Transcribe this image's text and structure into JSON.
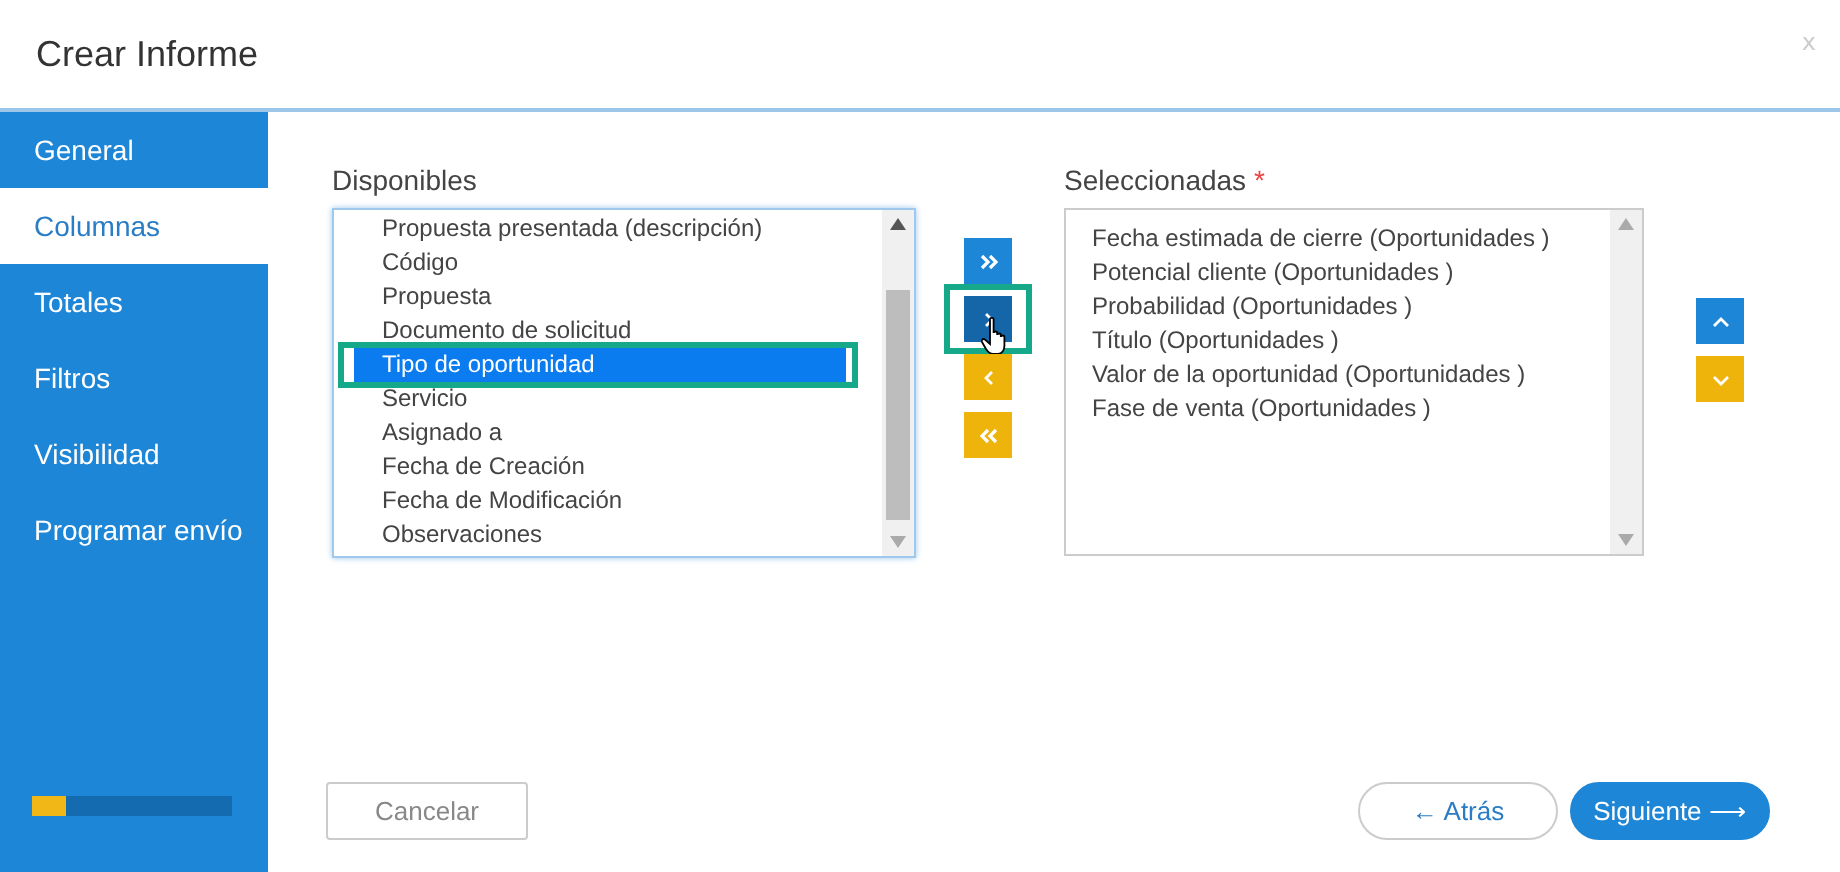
{
  "dialog": {
    "title": "Crear Informe",
    "close": "x"
  },
  "sidebar": {
    "items": [
      {
        "label": "General",
        "selected": false
      },
      {
        "label": "Columnas",
        "selected": true
      },
      {
        "label": "Totales",
        "selected": false
      },
      {
        "label": "Filtros",
        "selected": false
      },
      {
        "label": "Visibilidad",
        "selected": false
      },
      {
        "label": "Programar envío",
        "selected": false
      }
    ],
    "progress": {
      "level": 0.17
    }
  },
  "available": {
    "label": "Disponibles",
    "items": [
      {
        "label": "Propuesta presentada (descripción)",
        "selected": false,
        "highlighted": false
      },
      {
        "label": "Código",
        "selected": false,
        "highlighted": false
      },
      {
        "label": "Propuesta",
        "selected": false,
        "highlighted": false
      },
      {
        "label": "Documento de solicitud",
        "selected": false,
        "highlighted": false
      },
      {
        "label": "Tipo de oportunidad",
        "selected": true,
        "highlighted": true
      },
      {
        "label": "Servicio",
        "selected": false,
        "highlighted": false
      },
      {
        "label": "Asignado a",
        "selected": false,
        "highlighted": false
      },
      {
        "label": "Fecha de Creación",
        "selected": false,
        "highlighted": false
      },
      {
        "label": "Fecha de Modificación",
        "selected": false,
        "highlighted": false
      },
      {
        "label": "Observaciones",
        "selected": false,
        "highlighted": false
      }
    ]
  },
  "transfer_buttons": [
    {
      "kind": "add_all",
      "hovered": false,
      "highlighted": false
    },
    {
      "kind": "add",
      "hovered": true,
      "highlighted": true
    },
    {
      "kind": "remove",
      "hovered": false,
      "highlighted": false
    },
    {
      "kind": "remove_all",
      "hovered": false,
      "highlighted": false
    }
  ],
  "selected_list": {
    "label": "Seleccionadas",
    "required_mark": "*",
    "items": [
      {
        "label": "Fecha estimada de cierre (Oportunidades )"
      },
      {
        "label": "Potencial cliente (Oportunidades )"
      },
      {
        "label": "Probabilidad (Oportunidades )"
      },
      {
        "label": "Título (Oportunidades )"
      },
      {
        "label": "Valor de la oportunidad (Oportunidades )"
      },
      {
        "label": "Fase de venta (Oportunidades )"
      }
    ]
  },
  "order_buttons": [
    {
      "kind": "up"
    },
    {
      "kind": "down"
    }
  ],
  "footer": {
    "cancel": "Cancelar",
    "back": "← Atrás",
    "next": "Siguiente ⟶"
  }
}
